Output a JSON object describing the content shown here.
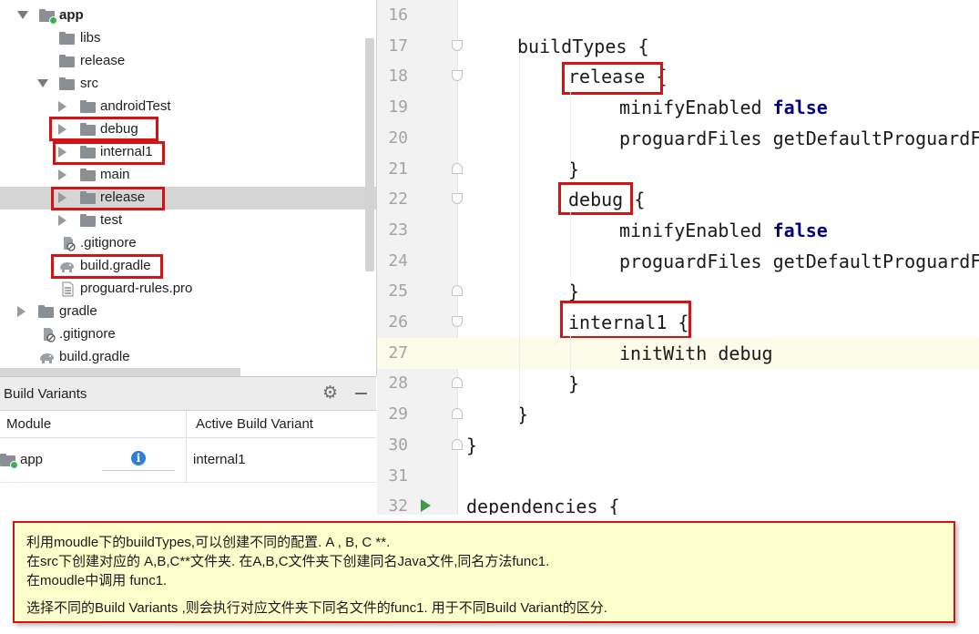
{
  "project_tree": {
    "items": [
      {
        "label": "app",
        "icon": "module-folder-icon",
        "expanded": true,
        "bold": true
      },
      {
        "label": "libs",
        "icon": "folder-icon"
      },
      {
        "label": "release",
        "icon": "folder-icon"
      },
      {
        "label": "src",
        "icon": "folder-icon",
        "expanded": true
      },
      {
        "label": "androidTest",
        "icon": "folder-icon",
        "expanded": false
      },
      {
        "label": "debug",
        "icon": "folder-icon",
        "expanded": false,
        "highlighted": true
      },
      {
        "label": "internal1",
        "icon": "folder-icon",
        "expanded": false,
        "highlighted": true
      },
      {
        "label": "main",
        "icon": "folder-icon",
        "expanded": false
      },
      {
        "label": "release",
        "icon": "folder-icon",
        "expanded": false,
        "highlighted": true,
        "selected": true
      },
      {
        "label": "test",
        "icon": "folder-icon",
        "expanded": false
      },
      {
        "label": ".gitignore",
        "icon": "ignore-file-icon"
      },
      {
        "label": "build.gradle",
        "icon": "gradle-elephant-icon",
        "highlighted": true
      },
      {
        "label": "proguard-rules.pro",
        "icon": "text-file-icon"
      },
      {
        "label": "gradle",
        "icon": "folder-icon",
        "expanded": false
      },
      {
        "label": ".gitignore",
        "icon": "ignore-file-icon"
      },
      {
        "label": "build.gradle",
        "icon": "gradle-elephant-icon"
      }
    ]
  },
  "build_variants": {
    "title": "Build Variants",
    "gear_icon": "gear-icon",
    "minimize_icon": "minimize-icon",
    "columns": [
      "Module",
      "Active Build Variant"
    ],
    "rows": [
      {
        "module": "app",
        "info_icon": "i",
        "variant": "internal1"
      }
    ]
  },
  "editor": {
    "lines": [
      {
        "num": "16",
        "tokens": []
      },
      {
        "num": "17",
        "tokens": [
          {
            "t": "buildTypes {",
            "kw": false
          }
        ]
      },
      {
        "num": "18",
        "tokens": [
          {
            "t": "release",
            "kw": false
          },
          {
            "t": " {",
            "kw": false
          }
        ]
      },
      {
        "num": "19",
        "tokens": [
          {
            "t": "minifyEnabled ",
            "kw": false
          },
          {
            "t": "false",
            "kw": true
          }
        ]
      },
      {
        "num": "20",
        "tokens": [
          {
            "t": "proguardFiles getDefaultProguardFile(",
            "kw": false
          }
        ]
      },
      {
        "num": "21",
        "tokens": [
          {
            "t": "}",
            "kw": false
          }
        ]
      },
      {
        "num": "22",
        "tokens": [
          {
            "t": "debug",
            "kw": false
          },
          {
            "t": " {",
            "kw": false
          }
        ]
      },
      {
        "num": "23",
        "tokens": [
          {
            "t": "minifyEnabled ",
            "kw": false
          },
          {
            "t": "false",
            "kw": true
          }
        ]
      },
      {
        "num": "24",
        "tokens": [
          {
            "t": "proguardFiles getDefaultProguardFile(",
            "kw": false
          }
        ]
      },
      {
        "num": "25",
        "tokens": [
          {
            "t": "}",
            "kw": false
          }
        ]
      },
      {
        "num": "26",
        "tokens": [
          {
            "t": "internal1",
            "kw": false
          },
          {
            "t": " {",
            "kw": false
          }
        ]
      },
      {
        "num": "27",
        "tokens": [
          {
            "t": "initWith debug",
            "kw": false
          }
        ]
      },
      {
        "num": "28",
        "tokens": [
          {
            "t": "}",
            "kw": false
          }
        ]
      },
      {
        "num": "29",
        "tokens": [
          {
            "t": "}",
            "kw": false
          }
        ]
      },
      {
        "num": "30",
        "tokens": [
          {
            "t": "}",
            "kw": false
          }
        ]
      },
      {
        "num": "31",
        "tokens": []
      },
      {
        "num": "32",
        "tokens": [
          {
            "t": "dependencies {",
            "kw": false
          }
        ]
      }
    ]
  },
  "note": {
    "lines": [
      "利用moudle下的buildTypes,可以创建不同的配置. A , B, C **.",
      "在src下创建对应的 A,B,C**文件夹. 在A,B,C文件夹下创建同名Java文件,同名方法func1.",
      "在moudle中调用 func1.",
      "选择不同的Build Variants ,则会执行对应文件夹下同名文件的func1. 用于不同Build Variant的区分."
    ]
  },
  "colors": {
    "highlight_red": "#d41414",
    "note_bg": "#ffffcc",
    "keyword": "#000080",
    "current_line": "#fcfae9"
  }
}
